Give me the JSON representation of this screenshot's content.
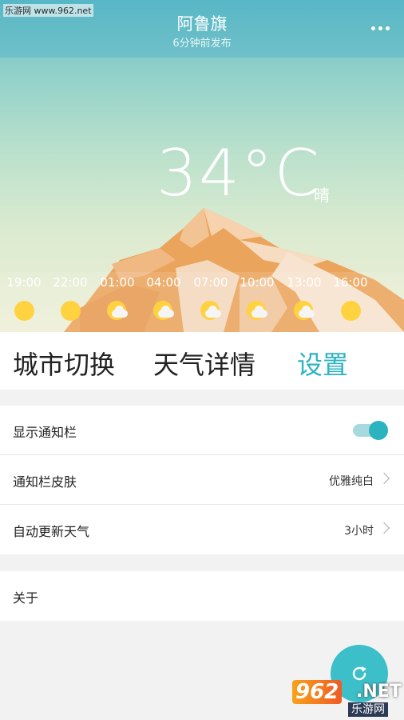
{
  "watermark": "乐游网 www.962.net",
  "header": {
    "city": "阿鲁旗",
    "published": "6分钟前发布",
    "more_icon": "more-dots-icon"
  },
  "current": {
    "temperature": "34°C",
    "condition": "晴"
  },
  "hourly": [
    {
      "time": "19:00",
      "icon": "sun-icon"
    },
    {
      "time": "22:00",
      "icon": "sun-icon"
    },
    {
      "time": "01:00",
      "icon": "partly-cloudy-icon"
    },
    {
      "time": "04:00",
      "icon": "partly-cloudy-icon"
    },
    {
      "time": "07:00",
      "icon": "partly-cloudy-icon"
    },
    {
      "time": "10:00",
      "icon": "partly-cloudy-icon"
    },
    {
      "time": "13:00",
      "icon": "partly-cloudy-icon"
    },
    {
      "time": "16:00",
      "icon": "sun-icon"
    }
  ],
  "tabs": [
    {
      "label": "城市切换",
      "active": false
    },
    {
      "label": "天气详情",
      "active": false
    },
    {
      "label": "设置",
      "active": true
    }
  ],
  "settings": {
    "notification_bar": {
      "label": "显示通知栏",
      "enabled": true
    },
    "notification_skin": {
      "label": "通知栏皮肤",
      "value": "优雅纯白"
    },
    "auto_update": {
      "label": "自动更新天气",
      "value": "3小时"
    },
    "about": {
      "label": "关于"
    }
  },
  "fab_icon": "refresh-icon",
  "logo": {
    "num": "962",
    "net": ".NET",
    "sub": "乐游网"
  },
  "colors": {
    "accent": "#2bb3c0",
    "sun": "#ffd23f",
    "mountain": "#e9a05a"
  }
}
